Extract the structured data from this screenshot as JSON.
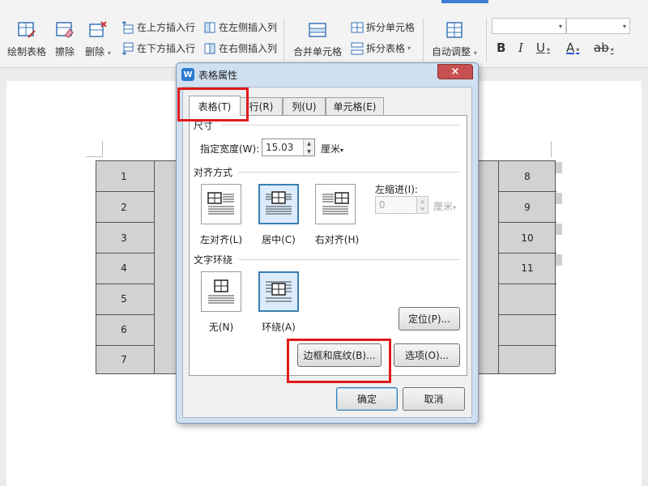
{
  "ribbon": {
    "draw_table": "绘制表格",
    "erase": "擦除",
    "delete": "删除",
    "insert_above": "在上方插入行",
    "insert_below": "在下方插入行",
    "insert_left": "在左侧插入列",
    "insert_right": "在右侧插入列",
    "merge_cells": "合并单元格",
    "split_cells": "拆分单元格",
    "split_table": "拆分表格",
    "auto_adjust": "自动调整",
    "bold": "B",
    "italic": "I",
    "underline": "U",
    "font_color": "A",
    "highlight": "ab"
  },
  "document": {
    "left_column": [
      "1",
      "2",
      "3",
      "4",
      "5",
      "6",
      "7"
    ],
    "right_column": [
      "8",
      "9",
      "10",
      "11"
    ]
  },
  "dialog": {
    "title": "表格属性",
    "close": "×",
    "tabs": [
      "表格(T)",
      "行(R)",
      "列(U)",
      "单元格(E)"
    ],
    "size_group": "尺寸",
    "width_label": "指定宽度(W):",
    "width_value": "15.03",
    "width_unit": "厘米",
    "alignment_group": "对齐方式",
    "align_left": "左对齐(L)",
    "align_center": "居中(C)",
    "align_right": "右对齐(H)",
    "left_indent_label": "左缩进(I):",
    "left_indent_value": "0",
    "left_indent_unit": "厘米",
    "wrap_group": "文字环绕",
    "wrap_none": "无(N)",
    "wrap_around": "环绕(A)",
    "positioning": "定位(P)...",
    "borders_shading": "边框和底纹(B)...",
    "options": "选项(O)...",
    "ok": "确定",
    "cancel": "取消"
  },
  "colors": {
    "highlight": "#e01b1b",
    "accent": "#3c7fb1",
    "table_fill": "#d2d2d2"
  }
}
